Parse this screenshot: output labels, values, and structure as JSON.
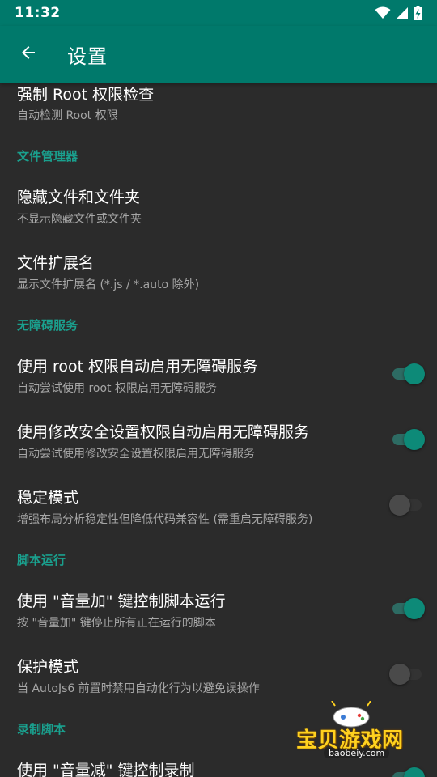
{
  "status_bar": {
    "time": "11:32",
    "icons": [
      "wifi-icon",
      "signal-icon",
      "battery-charging-icon"
    ]
  },
  "app_bar": {
    "back_icon": "arrow-back-icon",
    "title": "设置"
  },
  "colors": {
    "primary": "#00796b",
    "accent": "#1aa08e",
    "background": "#2b2b2b",
    "switch_on": "#0d8a78",
    "switch_off": "#4a4a4a"
  },
  "preferences": {
    "force_root": {
      "title": "强制 Root 权限检查",
      "summary": "自动检测 Root 权限"
    },
    "cat_file_manager": "文件管理器",
    "hidden_files": {
      "title": "隐藏文件和文件夹",
      "summary": "不显示隐藏文件或文件夹"
    },
    "file_extension": {
      "title": "文件扩展名",
      "summary": "显示文件扩展名 (*.js / *.auto 除外)"
    },
    "cat_accessibility": "无障碍服务",
    "root_accessibility": {
      "title": "使用 root 权限自动启用无障碍服务",
      "summary": "自动尝试使用 root 权限启用无障碍服务",
      "enabled": true
    },
    "secure_settings_accessibility": {
      "title": "使用修改安全设置权限自动启用无障碍服务",
      "summary": "自动尝试使用修改安全设置权限启用无障碍服务",
      "enabled": true
    },
    "stable_mode": {
      "title": "稳定模式",
      "summary": "增强布局分析稳定性但降低代码兼容性 (需重启无障碍服务)",
      "enabled": false
    },
    "cat_script_run": "脚本运行",
    "volume_up_control": {
      "title": "使用 \"音量加\" 键控制脚本运行",
      "summary": "按 \"音量加\" 键停止所有正在运行的脚本",
      "enabled": true
    },
    "guard_mode": {
      "title": "保护模式",
      "summary": "当 AutoJs6 前置时禁用自动化行为以避免误操作",
      "enabled": false
    },
    "cat_record_script": "录制脚本",
    "volume_down_record": {
      "title": "使用 \"音量减\" 键控制录制",
      "enabled": true
    }
  },
  "watermark": {
    "title": "宝贝游戏网",
    "url": "baobeiy.com"
  }
}
